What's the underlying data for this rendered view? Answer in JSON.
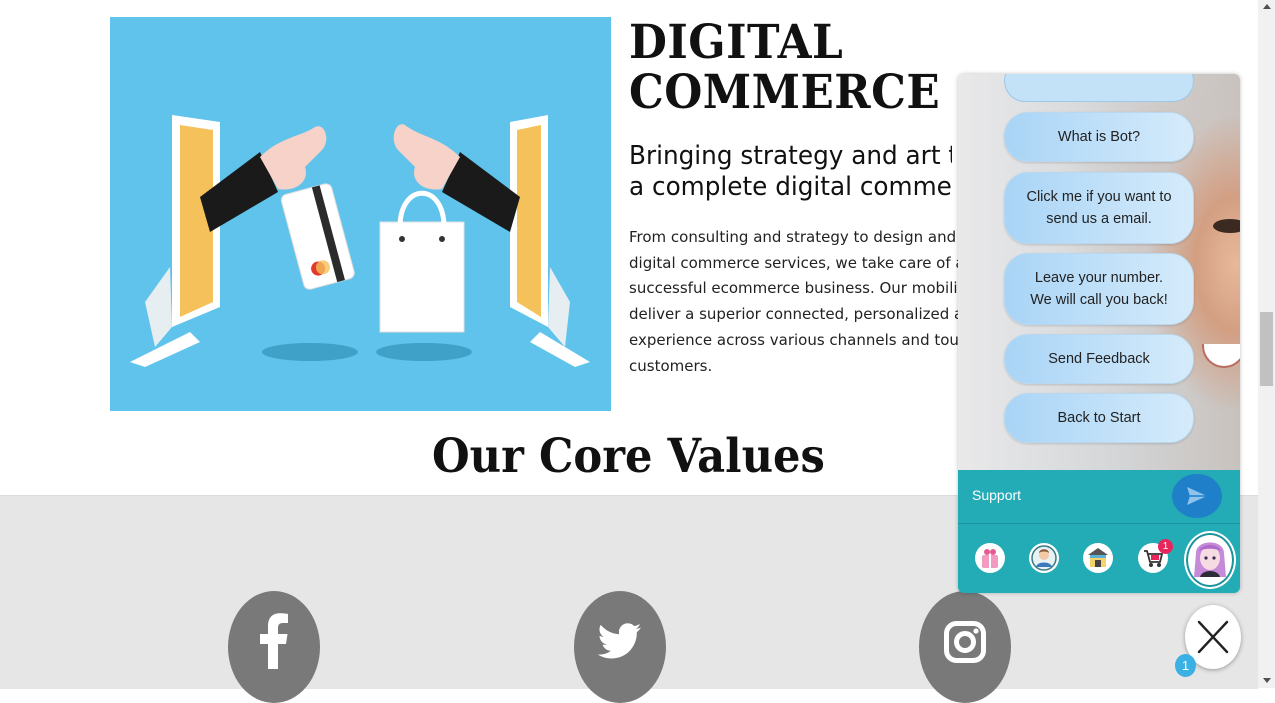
{
  "hero": {
    "title_line1": "DIGITAL",
    "title_line2": "COMMERCE",
    "subtitle_line1": "Bringing strategy and art to",
    "subtitle_line2": "a complete digital commerce",
    "body_lines": [
      "From consulting and strategy to design and digital",
      "digital commerce services, we take care of all th",
      "successful ecommerce business. Our mobility so",
      "deliver a superior connected, personalized and C",
      "experience across various channels and touch-p",
      "customers."
    ],
    "image_icon": "online-shopping-illustration-icon"
  },
  "core_values": {
    "heading": "Our Core Values",
    "social_icons": [
      "facebook-icon",
      "twitter-icon",
      "instagram-icon"
    ]
  },
  "chat": {
    "menu": [
      "What is Bot?",
      "Click me if you want to send us a email.",
      "Leave your number. We will call you back!",
      "Send Feedback",
      "Back to Start"
    ],
    "menu_lines": {
      "email_1": "Click me if you want to",
      "email_2": "send us a email.",
      "call_1": "Leave your number.",
      "call_2": "We will call you back!"
    },
    "input_placeholder": "Support",
    "send_icon": "send-arrow-icon",
    "tab_icons": [
      "gift-icon",
      "agent-icon",
      "shop-icon",
      "cart-icon",
      "bot-avatar-icon"
    ],
    "cart_badge": "1",
    "accent_color": "#23acb5"
  },
  "fab": {
    "close_icon": "close-x-icon",
    "badge": "1"
  }
}
